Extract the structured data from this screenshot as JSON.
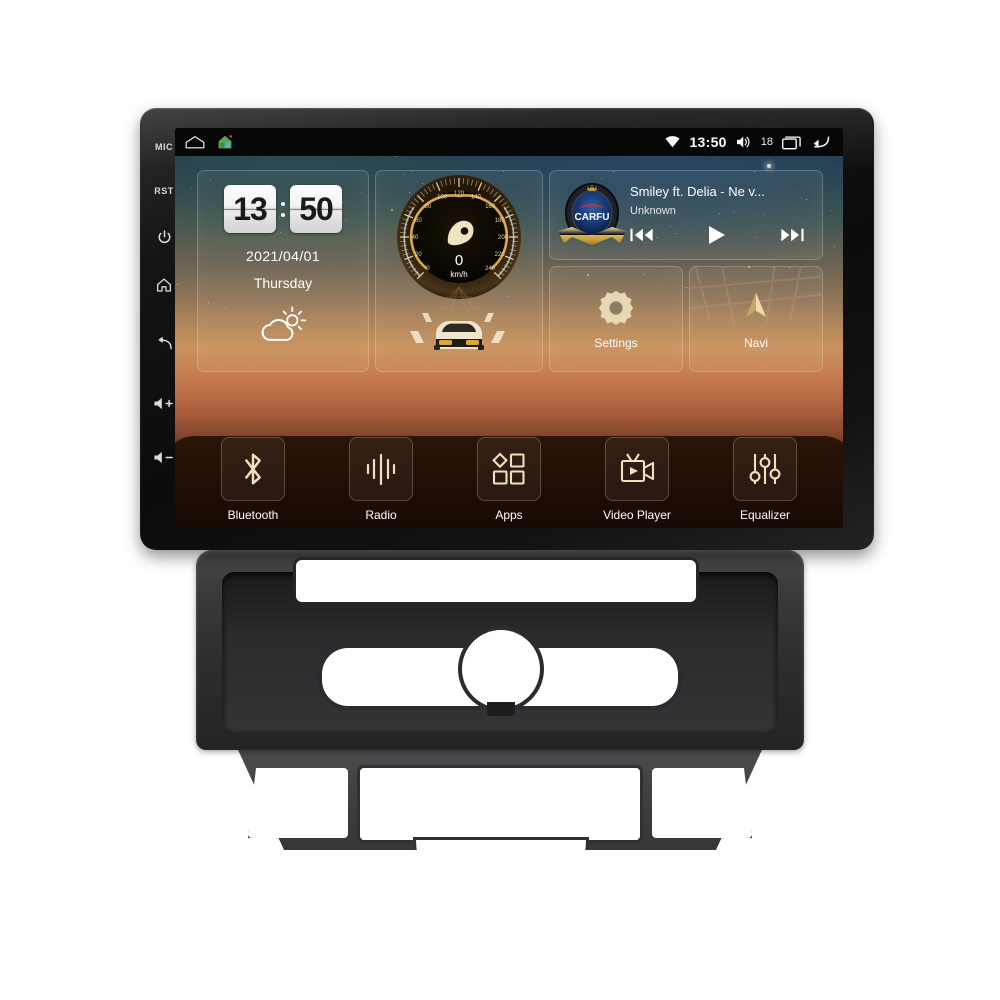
{
  "device": {
    "side_keys": [
      {
        "name": "mic",
        "label": "MIC"
      },
      {
        "name": "reset",
        "label": "RST"
      },
      {
        "name": "power",
        "label": ""
      },
      {
        "name": "home",
        "label": ""
      },
      {
        "name": "back",
        "label": ""
      },
      {
        "name": "volume-up",
        "label": ""
      },
      {
        "name": "volume-down",
        "label": ""
      }
    ]
  },
  "statusbar": {
    "left_icons": [
      "home-outline-icon",
      "house-app-icon"
    ],
    "wifi_icon": "wifi-icon",
    "time": "13:50",
    "volume_icon": "volume-icon",
    "volume_level": "18",
    "recents_icon": "recents-icon",
    "back_icon": "back-icon"
  },
  "clock_widget": {
    "hours": "13",
    "minutes": "50",
    "date": "2021/04/01",
    "weekday": "Thursday",
    "weather_icon": "partly-cloudy-icon"
  },
  "speed_widget": {
    "value": "0",
    "unit": "km/h",
    "ticks": [
      "0",
      "20",
      "40",
      "60",
      "80",
      "100",
      "120",
      "140",
      "160",
      "180",
      "200",
      "220",
      "240"
    ],
    "max": 240
  },
  "music_widget": {
    "logo_text": "CARFU",
    "title": "Smiley ft. Delia - Ne v...",
    "artist": "Unknown",
    "prev_icon": "previous-track-icon",
    "play_icon": "play-icon",
    "next_icon": "next-track-icon"
  },
  "tiles": [
    {
      "name": "settings",
      "label": "Settings",
      "icon": "gear-icon"
    },
    {
      "name": "navi",
      "label": "Navi",
      "icon": "navigation-arrow-icon"
    }
  ],
  "dock": [
    {
      "name": "bluetooth",
      "label": "Bluetooth",
      "icon": "bluetooth-icon"
    },
    {
      "name": "radio",
      "label": "Radio",
      "icon": "radio-waveform-icon"
    },
    {
      "name": "apps",
      "label": "Apps",
      "icon": "apps-grid-icon"
    },
    {
      "name": "video-player",
      "label": "Video Player",
      "icon": "video-camera-icon"
    },
    {
      "name": "equalizer",
      "label": "Equalizer",
      "icon": "equalizer-sliders-icon"
    }
  ],
  "colors": {
    "accent_gold": "#f0e0bd",
    "screen_top": "#1d3040",
    "screen_bottom": "#2a1309",
    "bezel": "#141416",
    "fascia": "#3a3a3c"
  }
}
